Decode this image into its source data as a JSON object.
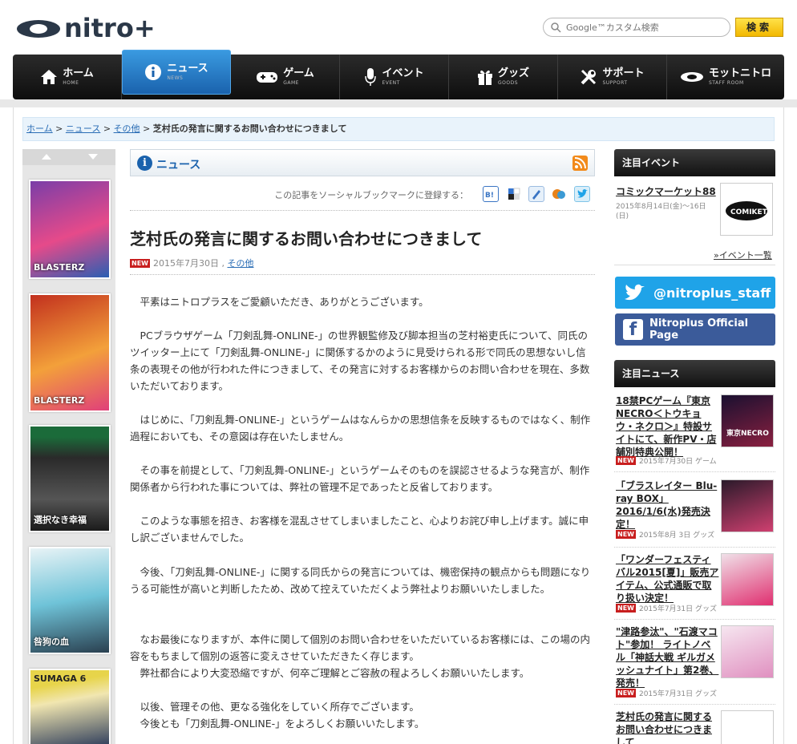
{
  "logo": {
    "text": "nitro+"
  },
  "search": {
    "placeholder": "Google™カスタム検索",
    "button": "検索"
  },
  "nav": [
    {
      "jp": "ホーム",
      "en": "HOME",
      "icon": "home-icon"
    },
    {
      "jp": "ニュース",
      "en": "NEWS",
      "icon": "info-icon"
    },
    {
      "jp": "ゲーム",
      "en": "GAME",
      "icon": "gamepad-icon"
    },
    {
      "jp": "イベント",
      "en": "EVENT",
      "icon": "microphone-icon"
    },
    {
      "jp": "グッズ",
      "en": "GOODS",
      "icon": "gift-icon"
    },
    {
      "jp": "サポート",
      "en": "SUPPORT",
      "icon": "tools-icon"
    },
    {
      "jp": "モットニトロ",
      "en": "STAFF ROOM",
      "icon": "nitro-mark-icon"
    }
  ],
  "breadcrumb": {
    "home": "ホーム",
    "news": "ニュース",
    "other": "その他",
    "sep": ">",
    "current": "芝村氏の発言に関するお問い合わせにつきまして"
  },
  "left_covers": [
    {
      "label": "BLASTERZ",
      "color1": "#7a3ea8",
      "color2": "#e64a8a"
    },
    {
      "label": "BLASTERZ",
      "color1": "#c2301e",
      "color2": "#f3a03a"
    },
    {
      "label": "選択なき幸福",
      "color1": "#1b6b3a",
      "color2": "#2a2a2a"
    },
    {
      "label": "咎狗の血",
      "color1": "#6fc3d8",
      "color2": "#e8f3f6"
    },
    {
      "label": "SUMAGA 6",
      "color1": "#e7d44a",
      "color2": "#2b3a5a"
    }
  ],
  "news_header": {
    "title": "ニュース"
  },
  "social": {
    "label": "この記事をソーシャルブックマークに登録する："
  },
  "article": {
    "title": "芝村氏の発言に関するお問い合わせにつきまして",
    "badge": "NEW",
    "date": "2015年7月30日",
    "date_sep": ",",
    "category": "その他",
    "paragraphs": [
      "平素はニトロプラスをご愛顧いただき、ありがとうございます。",
      "PCブラウザゲーム「刀剣乱舞-ONLINE-」の世界観監修及び脚本担当の芝村裕吏氏について、同氏のツイッター上にて「刀剣乱舞-ONLINE-」に関係するかのように見受けられる形で同氏の思想ないし信条の表現その他が行われた件につきまして、その発言に対するお客様からのお問い合わせを現在、多数いただいております。",
      "はじめに、「刀剣乱舞-ONLINE-」というゲームはなんらかの思想信条を反映するものではなく、制作過程においても、その意図は存在いたしません。",
      "その事を前提として、「刀剣乱舞-ONLINE-」というゲームそのものを誤認させるような発言が、制作関係者から行われた事については、弊社の管理不足であったと反省しております。",
      "このような事態を招き、お客様を混乱させてしまいましたこと、心よりお詫び申し上げます。誠に申し訳ございませんでした。",
      "今後、「刀剣乱舞-ONLINE-」に関する同氏からの発言については、機密保持の観点からも問題になりうる可能性が高いと判断したため、改めて控えていただくよう弊社よりお願いいたしました。",
      "なお最後になりますが、本件に関して個別のお問い合わせをいただいているお客様には、この場の内容をもちまして個別の返答に変えさせていただきたく存じます。",
      "弊社都合により大変恐縮ですが、何卒ご理解とご容赦の程よろしくお願いいたします。",
      "以後、管理その他、更なる強化をしていく所存でございます。",
      "今後とも「刀剣乱舞-ONLINE-」をよろしくお願いいたします。"
    ]
  },
  "right": {
    "event_header": "注目イベント",
    "event": {
      "title": "コミックマーケット88",
      "date": "2015年8月14日(金)〜16日(日)",
      "logo": "COMIKET"
    },
    "event_more": "»イベント一覧",
    "twitter": "@nitroplus_staff",
    "facebook": "Nitroplus Official Page",
    "news_header": "注目ニュース",
    "news": [
      {
        "title": "18禁PCゲーム『東京NECRO＜トウキョウ・ネクロ＞』特設サイトにて、新作PV・店舗別特典公開！",
        "badge": "NEW",
        "date": "2015年7月30日",
        "cat": "ゲーム",
        "thumb_text": "東京NECRO",
        "c1": "#1a1030",
        "c2": "#8a2040"
      },
      {
        "title": "「ブラスレイター Blu-ray BOX」2016/1/6(水)発売決定！",
        "badge": "NEW",
        "date": "2015年8月 3日",
        "cat": "グッズ",
        "thumb_text": "",
        "c1": "#2a1a2a",
        "c2": "#d04070"
      },
      {
        "title": "「ワンダーフェスティバル2015[夏]」販売アイテム、公式通販で取り扱い決定！",
        "badge": "NEW",
        "date": "2015年7月31日",
        "cat": "グッズ",
        "thumb_text": "",
        "c1": "#f0e0e8",
        "c2": "#e03070"
      },
      {
        "title": "\"津路参汰\"、\"石渡マコト\"参加！ ライトノベル「神話大戦 ギルガメッシュナイト」第2巻、発売！",
        "badge": "NEW",
        "date": "2015年7月31日",
        "cat": "グッズ",
        "thumb_text": "",
        "c1": "#f6e6f0",
        "c2": "#e090c0"
      },
      {
        "title": "芝村氏の発言に関するお問い合わせにつきまして",
        "badge": "",
        "date": "",
        "cat": "",
        "thumb_text": "",
        "c1": "#ffffff",
        "c2": "#dddddd"
      }
    ]
  }
}
